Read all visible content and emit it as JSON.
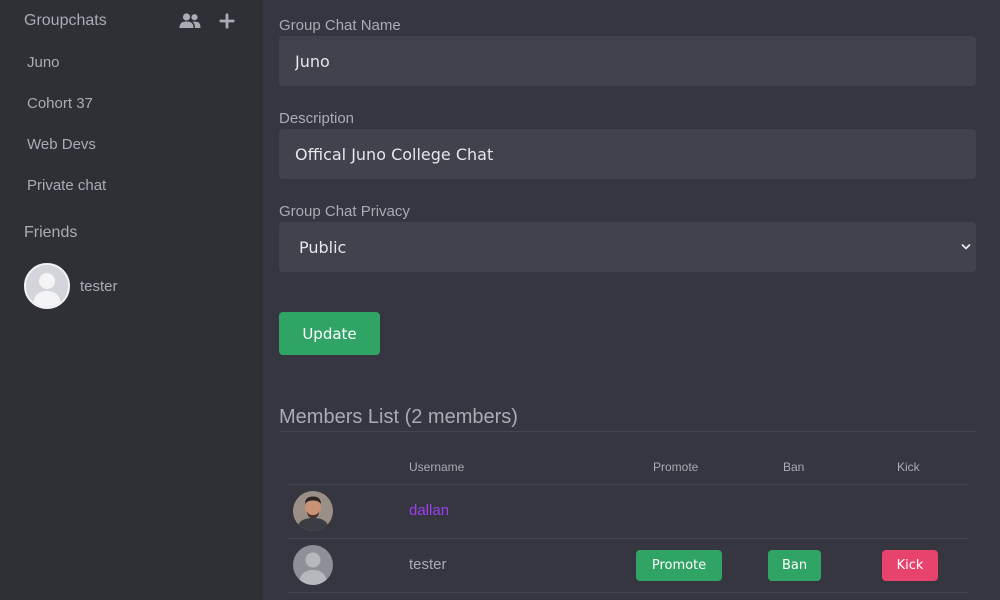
{
  "sidebar": {
    "groupchats_header": "Groupchats",
    "header_icons": [
      "people-icon",
      "plus-icon"
    ],
    "groupchats": [
      {
        "label": "Juno"
      },
      {
        "label": "Cohort 37"
      },
      {
        "label": "Web Devs"
      },
      {
        "label": "Private chat"
      }
    ],
    "friends_header": "Friends",
    "friends": [
      {
        "name": "tester",
        "avatar": "default-avatar-icon"
      }
    ]
  },
  "form": {
    "name_label": "Group Chat Name",
    "name_value": "Juno",
    "description_label": "Description",
    "description_value": "Offical Juno College Chat",
    "privacy_label": "Group Chat Privacy",
    "privacy_value": "Public",
    "update_label": "Update"
  },
  "members": {
    "title": "Members List (2 members)",
    "columns": {
      "username": "Username",
      "promote": "Promote",
      "ban": "Ban",
      "kick": "Kick"
    },
    "rows": [
      {
        "username": "dallan",
        "avatar": "photo-avatar-icon",
        "promote": "",
        "ban": "",
        "kick": ""
      },
      {
        "username": "tester",
        "avatar": "default-avatar-icon",
        "promote": "Promote",
        "ban": "Ban",
        "kick": "Kick"
      }
    ]
  },
  "colors": {
    "sidebar_bg": "#2f3036",
    "main_bg": "#35363f",
    "input_bg": "#41424b",
    "text": "#a9acb4",
    "accent_green": "#2fa465",
    "danger": "#e8436c",
    "owner_name": "#9b3ff2"
  }
}
